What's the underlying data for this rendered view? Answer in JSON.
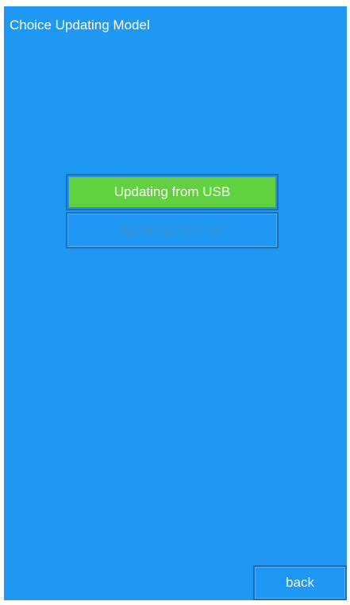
{
  "header": {
    "title": "Choice Updating Model"
  },
  "update_options": [
    {
      "label": "Updating from USB",
      "state": "selected"
    },
    {
      "label": "Updating from Net",
      "state": "disabled"
    }
  ],
  "footer": {
    "back_label": "back"
  },
  "colors": {
    "background": "#1e98f2",
    "selected": "#62d13f",
    "border": "#1a6fb7",
    "text": "#ffffff"
  }
}
